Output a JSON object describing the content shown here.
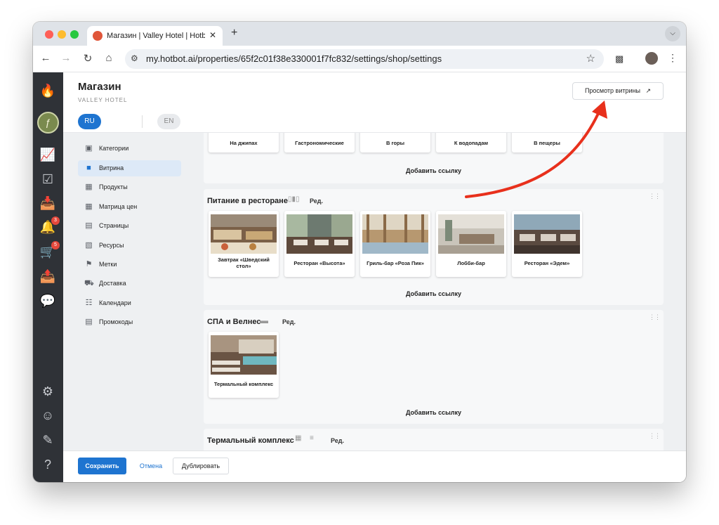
{
  "browser": {
    "tab_title": "Магазин | Valley Hotel | Hotbot",
    "tab_close": "✕",
    "new_tab": "+",
    "url": "my.hotbot.ai/properties/65f2c01f38e330001f7fc832/settings/shop/settings",
    "icons": [
      "back-icon",
      "forward-icon",
      "reload-icon",
      "home-icon",
      "site-settings-icon",
      "star-icon",
      "extensions-icon",
      "profile-icon",
      "menu-icon"
    ]
  },
  "rail": {
    "badges": {
      "notifications": "3",
      "cart": "5"
    },
    "icons": [
      "hotbot-logo-icon",
      "analytics-icon",
      "tasks-icon",
      "inbox-icon",
      "notifications-icon",
      "cart-icon",
      "send-icon",
      "chat-icon",
      "settings-icon",
      "account-icon",
      "edit-icon",
      "help-icon"
    ]
  },
  "header": {
    "title": "Магазин",
    "subtitle": "VALLEY HOTEL",
    "preview_button": "Просмотр витрины",
    "preview_icon": "↗",
    "languages": [
      "RU",
      "EN"
    ]
  },
  "sidebar": {
    "items": [
      {
        "label": "Категории",
        "icon": "categories-icon"
      },
      {
        "label": "Витрина",
        "icon": "showcase-icon"
      },
      {
        "label": "Продукты",
        "icon": "products-icon"
      },
      {
        "label": "Матрица цен",
        "icon": "price-matrix-icon"
      },
      {
        "label": "Страницы",
        "icon": "pages-icon"
      },
      {
        "label": "Ресурсы",
        "icon": "resources-icon"
      },
      {
        "label": "Метки",
        "icon": "tags-icon"
      },
      {
        "label": "Доставка",
        "icon": "delivery-icon"
      },
      {
        "label": "Календари",
        "icon": "calendars-icon"
      },
      {
        "label": "Промокоды",
        "icon": "promocodes-icon"
      }
    ]
  },
  "sections": {
    "top": {
      "cards": [
        "На джипах",
        "Гастрономические",
        "В горы",
        "К водопадам",
        "В пещеры"
      ],
      "add_link": "Добавить ссылку"
    },
    "restaurant": {
      "title": "Питание в ресторане",
      "edit": "Ред.",
      "cards": [
        "Завтрак «Шведский стол»",
        "Ресторан «Высота»",
        "Гриль-бар «Роза Пик»",
        "Лобби-бар",
        "Ресторан «Эдем»"
      ],
      "add_link": "Добавить ссылку"
    },
    "spa": {
      "title": "СПА и Велнес",
      "edit": "Ред.",
      "cards": [
        "Термальный комплекс"
      ],
      "add_link": "Добавить ссылку"
    },
    "thermal": {
      "title": "Термальный комплекс",
      "edit": "Ред."
    }
  },
  "footer": {
    "save": "Сохранить",
    "cancel": "Отмена",
    "duplicate": "Дублировать"
  },
  "colors": {
    "accent": "#1e74d0",
    "rail": "#2f3237",
    "badge": "#e5483c",
    "annotation_arrow": "#e8301c"
  }
}
